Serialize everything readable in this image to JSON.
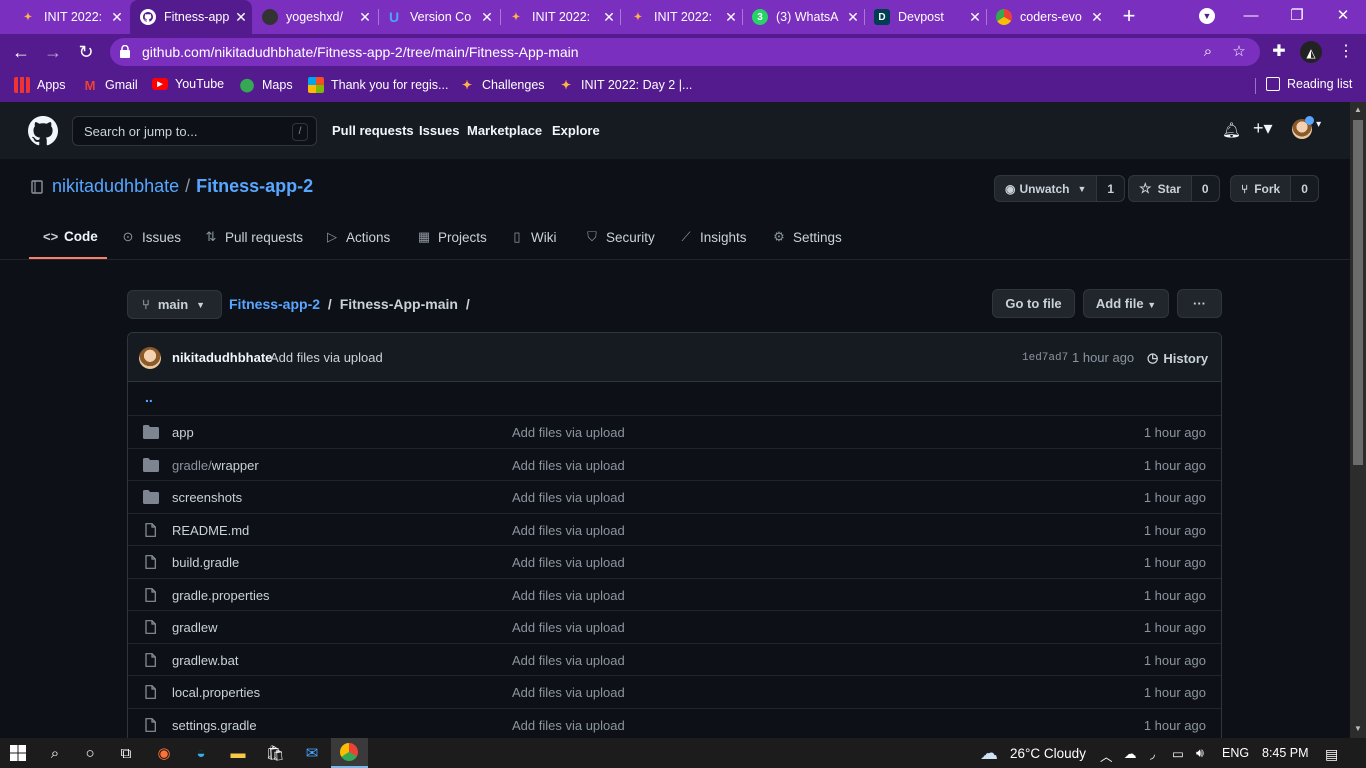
{
  "browser": {
    "tabs": [
      {
        "title": "INIT 2022:",
        "favicon": "init-favicon",
        "active": false
      },
      {
        "title": "Fitness-app",
        "favicon": "github-favicon",
        "active": true
      },
      {
        "title": "yogeshxd/",
        "favicon": "github-favicon",
        "active": false
      },
      {
        "title": "Version Co",
        "favicon": "unstop-favicon",
        "active": false
      },
      {
        "title": "INIT 2022:",
        "favicon": "init-favicon",
        "active": false
      },
      {
        "title": "INIT 2022:",
        "favicon": "init-favicon",
        "active": false
      },
      {
        "title": "(3) WhatsA",
        "favicon": "whatsapp-favicon",
        "badge": "3",
        "active": false
      },
      {
        "title": "Devpost",
        "favicon": "devpost-favicon",
        "badge": "D",
        "active": false
      },
      {
        "title": "coders-evo",
        "favicon": "google-drive-favicon",
        "active": false
      }
    ],
    "url": "github.com/nikitadudhbhate/Fitness-app-2/tree/main/Fitness-App-main",
    "bookmarks": [
      {
        "label": "Apps",
        "icon": "apps-grid-icon"
      },
      {
        "label": "Gmail",
        "icon": "gmail-icon"
      },
      {
        "label": "YouTube",
        "icon": "youtube-icon"
      },
      {
        "label": "Maps",
        "icon": "maps-icon"
      },
      {
        "label": "Thank you for regis...",
        "icon": "microsoft-icon"
      },
      {
        "label": "Challenges",
        "icon": "init-favicon"
      },
      {
        "label": "INIT 2022: Day 2 |...",
        "icon": "init-favicon"
      }
    ],
    "reading_list": "Reading list"
  },
  "github": {
    "search_placeholder": "Search or jump to...",
    "search_shortcut": "/",
    "nav": [
      "Pull requests",
      "Issues",
      "Marketplace",
      "Explore"
    ],
    "repo_owner": "nikitadudhbhate",
    "repo_separator": "/",
    "repo_name": "Fitness-app-2",
    "unwatch": {
      "label": "Unwatch",
      "count": "1"
    },
    "star": {
      "label": "Star",
      "count": "0"
    },
    "fork": {
      "label": "Fork",
      "count": "0"
    },
    "repo_tabs": [
      "Code",
      "Issues",
      "Pull requests",
      "Actions",
      "Projects",
      "Wiki",
      "Security",
      "Insights",
      "Settings"
    ],
    "branch": "main",
    "breadcrumb_repo": "Fitness-app-2",
    "breadcrumb_sep": "/",
    "breadcrumb_dir": "Fitness-App-main",
    "breadcrumb_trail": "/",
    "go_to_file": "Go to file",
    "add_file": "Add file",
    "more": "···",
    "commit": {
      "author": "nikitadudhbhate",
      "message": "Add files via upload",
      "sha": "1ed7ad7",
      "time": "1 hour ago",
      "history": "History"
    },
    "parent_dir": "..",
    "files": [
      {
        "type": "dir",
        "name": "app",
        "message": "Add files via upload",
        "age": "1 hour ago"
      },
      {
        "type": "dir",
        "name_prefix": "gradle/",
        "name": "wrapper",
        "message": "Add files via upload",
        "age": "1 hour ago"
      },
      {
        "type": "dir",
        "name": "screenshots",
        "message": "Add files via upload",
        "age": "1 hour ago"
      },
      {
        "type": "file",
        "name": "README.md",
        "message": "Add files via upload",
        "age": "1 hour ago"
      },
      {
        "type": "file",
        "name": "build.gradle",
        "message": "Add files via upload",
        "age": "1 hour ago"
      },
      {
        "type": "file",
        "name": "gradle.properties",
        "message": "Add files via upload",
        "age": "1 hour ago"
      },
      {
        "type": "file",
        "name": "gradlew",
        "message": "Add files via upload",
        "age": "1 hour ago"
      },
      {
        "type": "file",
        "name": "gradlew.bat",
        "message": "Add files via upload",
        "age": "1 hour ago"
      },
      {
        "type": "file",
        "name": "local.properties",
        "message": "Add files via upload",
        "age": "1 hour ago"
      },
      {
        "type": "file",
        "name": "settings.gradle",
        "message": "Add files via upload",
        "age": "1 hour ago"
      }
    ]
  },
  "taskbar": {
    "weather": "26°C  Cloudy",
    "language": "ENG",
    "time": "8:45 PM"
  },
  "colors": {
    "browser_tab_strip": "#7b2fbe",
    "browser_toolbar": "#541b8f",
    "gh_bg": "#0d1117",
    "gh_header": "#161b22",
    "link": "#58a6ff",
    "tab_underline": "#f78166"
  }
}
